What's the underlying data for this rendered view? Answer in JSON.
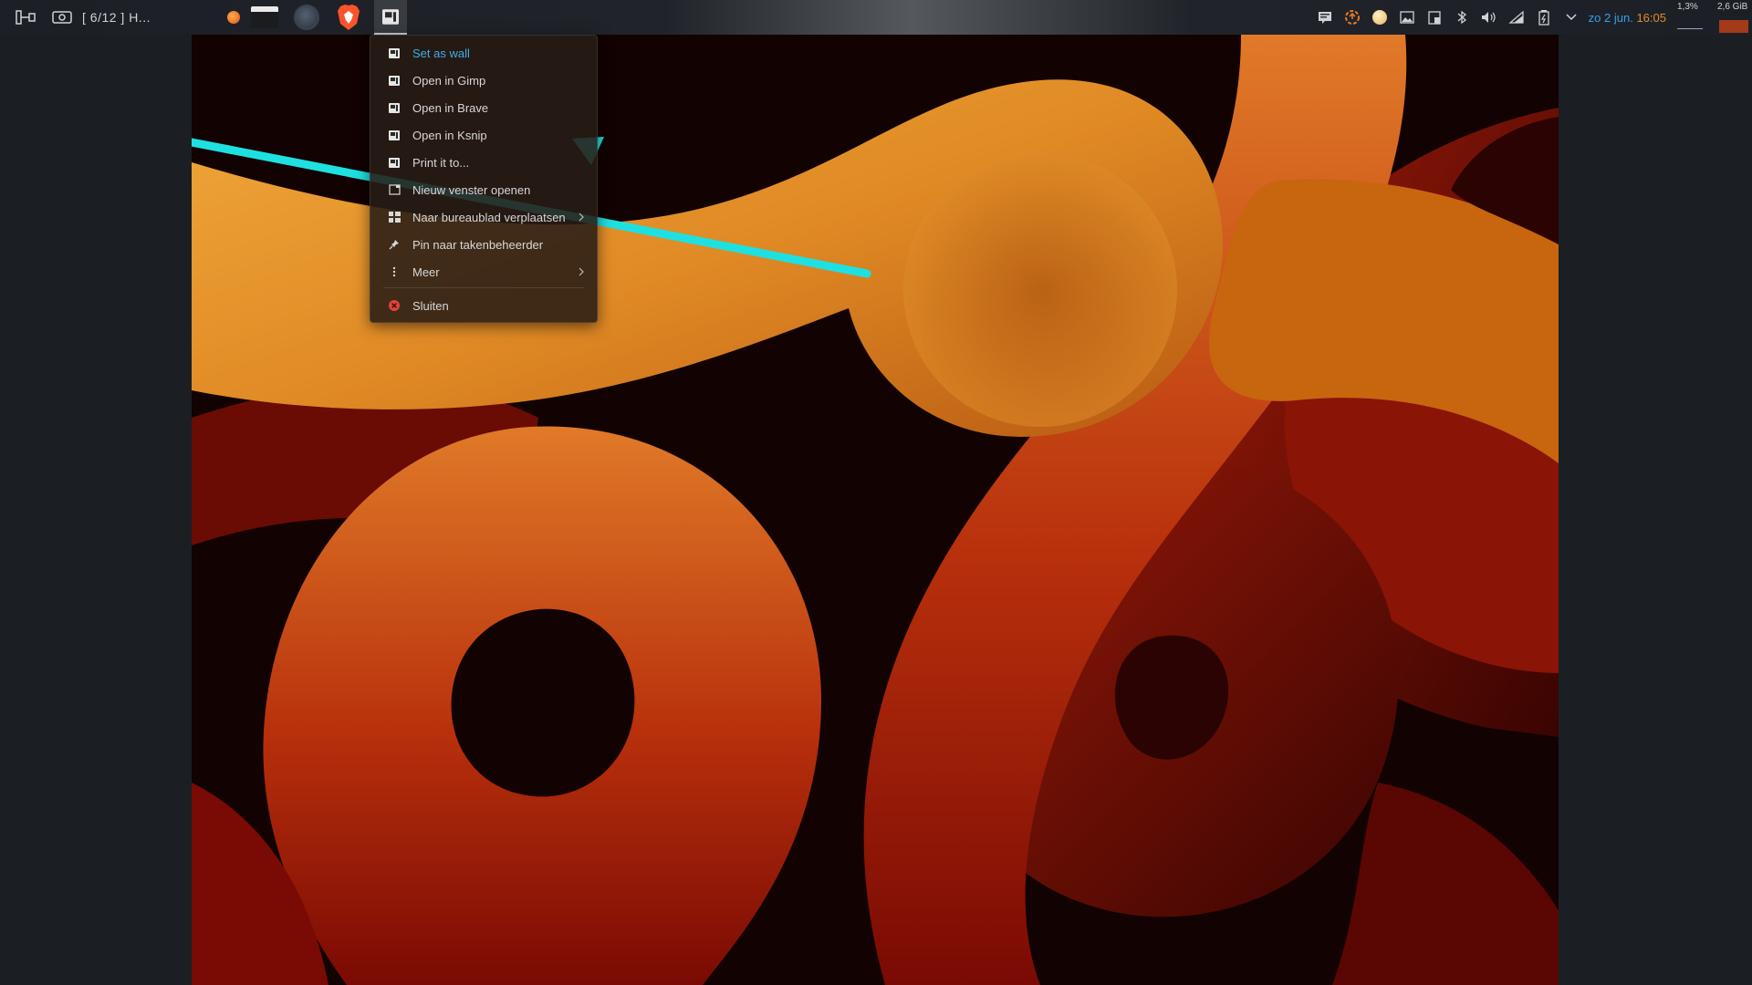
{
  "panel": {
    "workspace_label": "[ 6/12 ]  H...",
    "clock": {
      "date": "zo 2 jun.",
      "time": "16:05"
    },
    "stats": {
      "cpu": "1,3%",
      "memory": "2,6 GiB"
    },
    "launcher_icon": "window-switch-icon",
    "screenshot_icon": "screenshot-icon",
    "tasks": [
      {
        "name": "firefox-dot-icon"
      },
      {
        "name": "terminal-window-icon"
      },
      {
        "name": "circle-app-icon"
      },
      {
        "name": "brave-icon"
      },
      {
        "name": "image-viewer-icon",
        "active": true
      }
    ],
    "tray_icons": [
      "notes-icon",
      "updates-icon",
      "weather-icon",
      "image-icon",
      "clipboard-icon",
      "bluetooth-icon",
      "volume-icon",
      "network-icon",
      "battery-icon",
      "chevron-down-icon"
    ]
  },
  "menu": {
    "items": [
      {
        "label": "Set as wall",
        "icon": "image-viewer-icon",
        "highlight": true
      },
      {
        "label": "Open in Gimp",
        "icon": "image-viewer-icon"
      },
      {
        "label": "Open in Brave",
        "icon": "image-viewer-icon"
      },
      {
        "label": "Open in Ksnip",
        "icon": "image-viewer-icon"
      },
      {
        "label": "Print it to...",
        "icon": "image-viewer-icon"
      },
      {
        "label": "Nieuw venster openen",
        "icon": "new-window-icon"
      },
      {
        "label": "Naar bureaublad verplaatsen",
        "icon": "desktop-grid-icon",
        "submenu": true
      },
      {
        "label": "Pin naar takenbeheerder",
        "icon": "pin-icon"
      },
      {
        "label": "Meer",
        "icon": "more-vertical-icon",
        "submenu": true
      },
      {
        "label": "Sluiten",
        "icon": "close-circle-icon"
      }
    ]
  },
  "colors": {
    "accent_blue": "#3daee9",
    "clock_time": "#e58a2a",
    "annotation_arrow": "#1fe0e0"
  }
}
